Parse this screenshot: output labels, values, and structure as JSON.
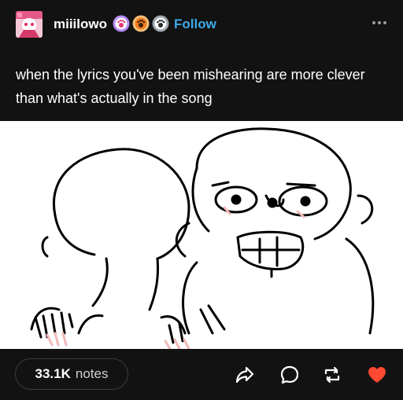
{
  "post": {
    "author": {
      "username": "miiilowo",
      "avatar_icon": "avatar-image",
      "badges": [
        "purple-paw-badge",
        "orange-paw-badge",
        "gray-paw-badge"
      ]
    },
    "follow_label": "Follow",
    "more_icon": "more-options-icon",
    "caption": "when the lyrics you've been mishearing are more clever than what's actually in the song",
    "image_description_icon": "meme-drawing",
    "notes": {
      "count": "33.1K",
      "label": "notes"
    },
    "actions": [
      "share-icon",
      "reply-icon",
      "reblog-icon",
      "like-icon"
    ]
  },
  "colors": {
    "background": "#121212",
    "follow": "#3fa9e8",
    "like": "#ff4930",
    "icon": "#ffffff"
  }
}
